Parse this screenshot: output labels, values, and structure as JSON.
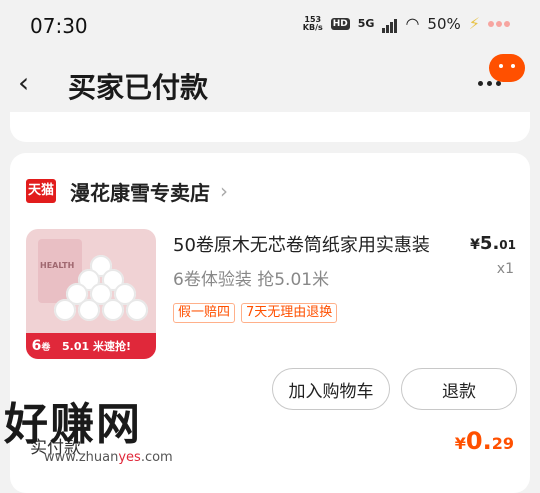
{
  "status_bar": {
    "time": "07:30",
    "net_speed_value": "153",
    "net_speed_unit": "KB/s",
    "hd": "HD",
    "network": "5G",
    "battery": "50%"
  },
  "nav": {
    "back_glyph": "‹",
    "title": "买家已付款"
  },
  "shop": {
    "logo_text": "天猫",
    "name": "漫花康雪专卖店",
    "arrow": "›"
  },
  "product": {
    "title": "50卷原木无芯卷筒纸家用实惠装",
    "spec": "6卷体验装 抢5.01米",
    "tags": [
      "假一赔四",
      "7天无理由退换"
    ],
    "price_currency": "¥",
    "price_int": "5.",
    "price_dec": "01",
    "qty": "x1",
    "thumb": {
      "pack_label": "HEALTH",
      "count": "6",
      "count_unit": "卷",
      "banner": "5.01 米速抢!"
    }
  },
  "actions": {
    "add_to_cart": "加入购物车",
    "refund": "退款"
  },
  "payment": {
    "label": "实付款",
    "currency": "¥",
    "int": "0.",
    "dec": "29"
  },
  "watermark": {
    "text": "好赚网",
    "url_prefix": "www.zhuan",
    "url_highlight": "yes",
    "url_suffix": ".com"
  }
}
